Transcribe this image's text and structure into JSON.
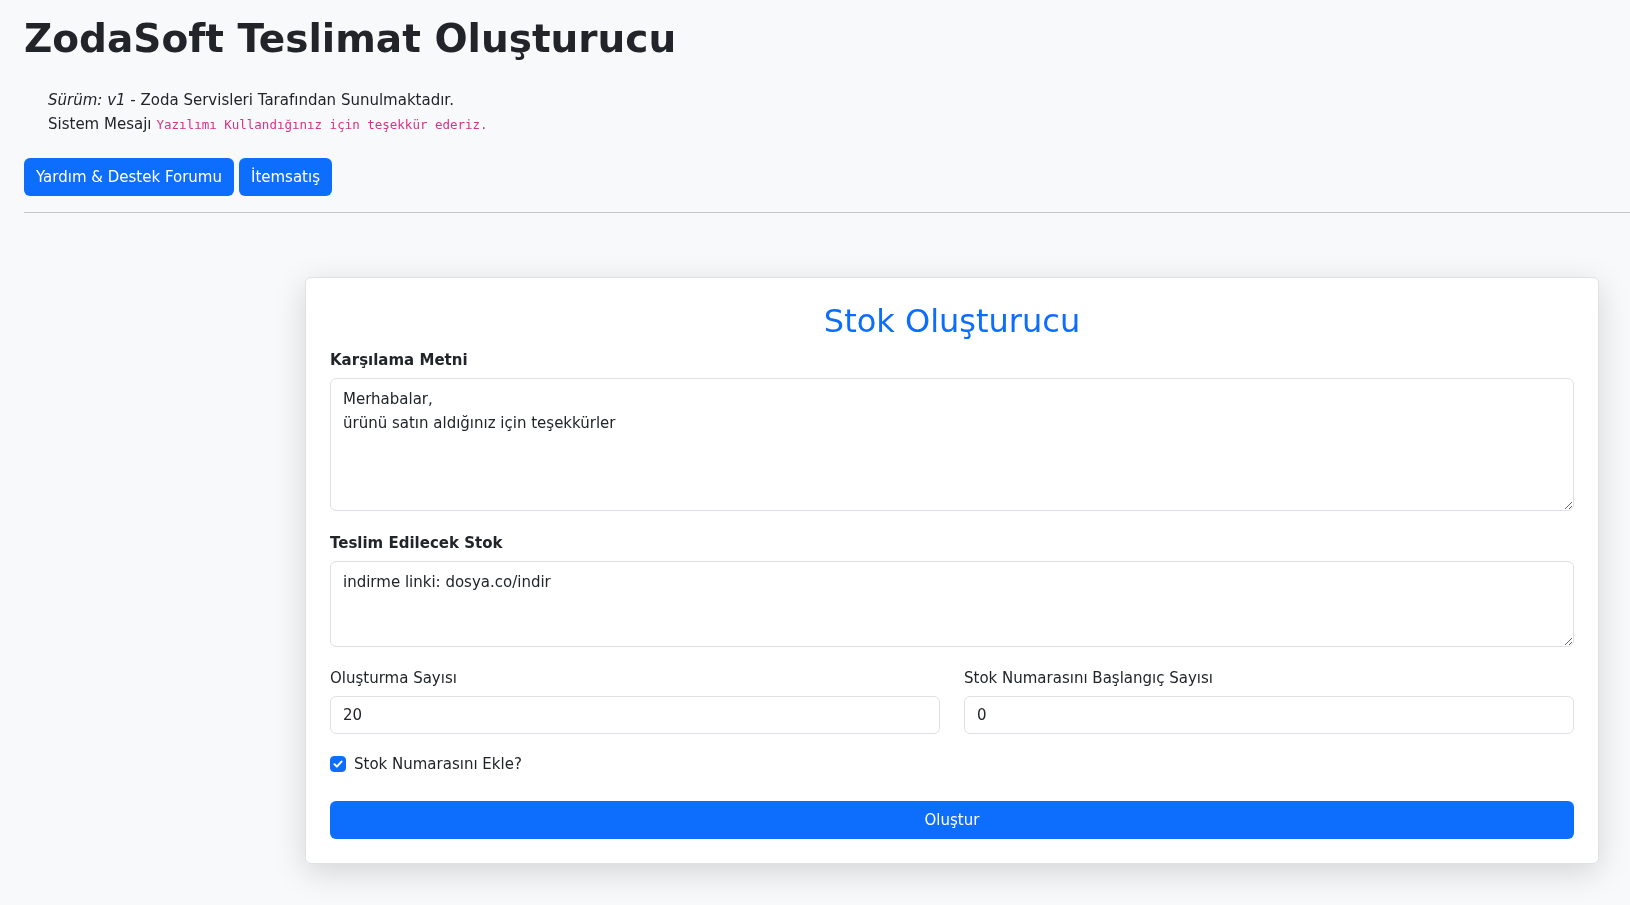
{
  "header": {
    "title": "ZodaSoft Teslimat Oluşturucu",
    "version_line": "*Sürüm: v1* - Zoda Servisleri Tarafından Sunulmaktadır.",
    "system_message_label": "Sistem Mesajı",
    "system_message": "Yazılımı Kullandığınız için teşekkür ederiz.",
    "buttons": [
      "Yardım & Destek Forumu",
      "İtemsatış"
    ]
  },
  "card": {
    "title": "Stok Oluşturucu",
    "greeting": {
      "label": "Karşılama Metni",
      "value": "Merhabalar,\nürünü satın aldığınız için teşekkürler"
    },
    "stock": {
      "label": "Teslim Edilecek Stok",
      "value": "indirme linki: dosya.co/indir"
    },
    "count": {
      "label": "Oluşturma Sayısı",
      "value": "20"
    },
    "start": {
      "label": "Stok Numarasını Başlangıç Sayısı",
      "value": "0"
    },
    "add_number": {
      "label": "Stok Numarasını Ekle?",
      "checked": true
    },
    "submit": "Oluştur"
  }
}
